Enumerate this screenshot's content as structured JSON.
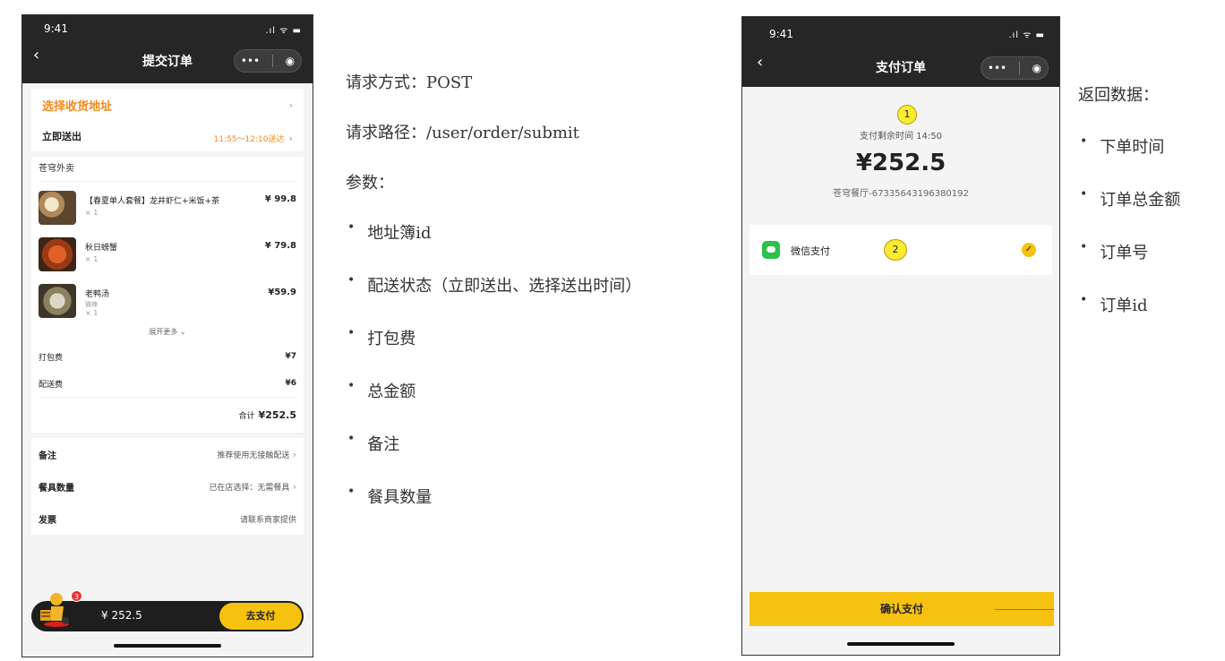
{
  "phone1": {
    "status_time": "9:41",
    "status_icons": ".ıl ᯤ ▬",
    "title": "提交订单",
    "address_title": "选择收货地址",
    "delivery_label": "立即送出",
    "delivery_time": "11:55～12:10送达",
    "shop_name": "苍穹外卖",
    "items": [
      {
        "name": "【春夏单人套餐】龙井虾仁+米饭+茶",
        "sub": "",
        "qty": "× 1",
        "price": "¥ 99.8"
      },
      {
        "name": "秋日螃蟹",
        "sub": "",
        "qty": "× 1",
        "price": "¥ 79.8"
      },
      {
        "name": "老鸭汤",
        "sub": "微辣",
        "qty": "× 1",
        "price": "¥59.9"
      }
    ],
    "expand_more": "展开更多 ⌄",
    "pack_fee_label": "打包费",
    "pack_fee_value": "¥7",
    "delivery_fee_label": "配送费",
    "delivery_fee_value": "¥6",
    "total_label": "合计",
    "total_value": "¥252.5",
    "remark_label": "备注",
    "remark_value": "推荐使用无接触配送",
    "tableware_label": "餐具数量",
    "tableware_value": "已在店选择：无需餐具",
    "invoice_label": "发票",
    "invoice_value": "请联系商家提供",
    "cart_badge": "3",
    "cart_amount": "¥ 252.5",
    "pay_button": "去支付"
  },
  "phone2": {
    "status_time": "9:41",
    "status_icons": ".ıl ᯤ ▬",
    "title": "支付订单",
    "annotation_1": "1",
    "remaining_time": "支付剩余时间 14:50",
    "amount": "¥252.5",
    "shop_order": "苍穹餐厅-67335643196380192",
    "method_label": "微信支付",
    "annotation_2": "2",
    "confirm_button": "确认支付"
  },
  "api_doc": {
    "method_line": "请求方式：POST",
    "path_line": "请求路径：/user/order/submit",
    "params_title": "参数：",
    "params": [
      "地址簿id",
      "配送状态（立即送出、选择送出时间）",
      "打包费",
      "总金额",
      "备注",
      "餐具数量"
    ]
  },
  "return_doc": {
    "title": "返回数据：",
    "items": [
      "下单时间",
      "订单总金额",
      "订单号",
      "订单id"
    ]
  },
  "colors": {
    "accent": "#f6c20f",
    "address_orange": "#f28a1e",
    "nav_dark": "#262626",
    "wechat_green": "#2bc14a"
  }
}
